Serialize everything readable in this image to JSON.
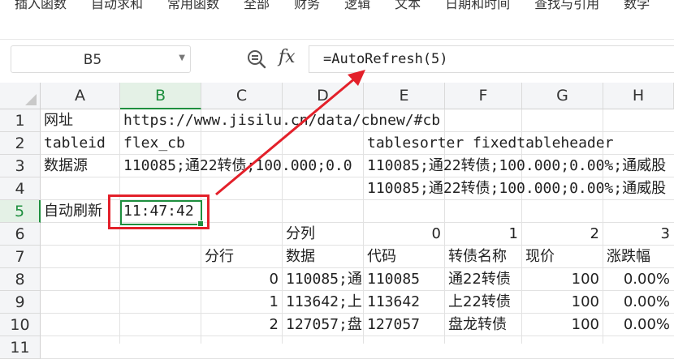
{
  "ribbon": {
    "items": [
      "插入函数",
      "自动求和",
      "常用函数",
      "全部",
      "财务",
      "逻辑",
      "文本",
      "日期和时间",
      "查找与引用",
      "数学"
    ]
  },
  "namebox": {
    "value": "B5"
  },
  "formula_bar": {
    "fx_label": "fx",
    "formula": "=AutoRefresh(5)"
  },
  "columns": [
    "A",
    "B",
    "C",
    "D",
    "E",
    "F",
    "G",
    "H"
  ],
  "rows": [
    "1",
    "2",
    "3",
    "4",
    "5",
    "6",
    "7",
    "8",
    "9",
    "10",
    "11"
  ],
  "selected": {
    "column": "B",
    "row": "5"
  },
  "cells": {
    "A1": "网址",
    "B1": "https://www.jisilu.cn/data/cbnew/#cb",
    "A2": "tableid",
    "B2": "flex_cb",
    "E2": "tablesorter fixedtableheader",
    "A3": "数据源",
    "B3": "110085;通22转债;100.000;0.0",
    "E3": "110085;通22转债;100.000;0.00%;通威股",
    "E4": "110085;通22转债;100.000;0.00%;通威股",
    "A5": "自动刷新",
    "B5": "11:47:42",
    "D6": "分列",
    "E6": "0",
    "F6": "1",
    "G6": "2",
    "H6": "3",
    "C7": "分行",
    "D7": "数据",
    "E7": "代码",
    "F7": "转债名称",
    "G7": "现价",
    "H7": "涨跌幅",
    "C8": "0",
    "D8": "110085;通",
    "E8": "110085",
    "F8": "通22转债",
    "G8": "100",
    "H8": "0.00%",
    "C9": "1",
    "D9": "113642;上",
    "E9": "113642",
    "F9": "上22转债",
    "G9": "100",
    "H9": "0.00%",
    "C10": "2",
    "D10": "127057;盘",
    "E10": "127057",
    "F10": "盘龙转债",
    "G10": "100",
    "H10": "0.00%"
  },
  "accent_color": "#1e8f3e",
  "annotation_color": "#e3202a"
}
